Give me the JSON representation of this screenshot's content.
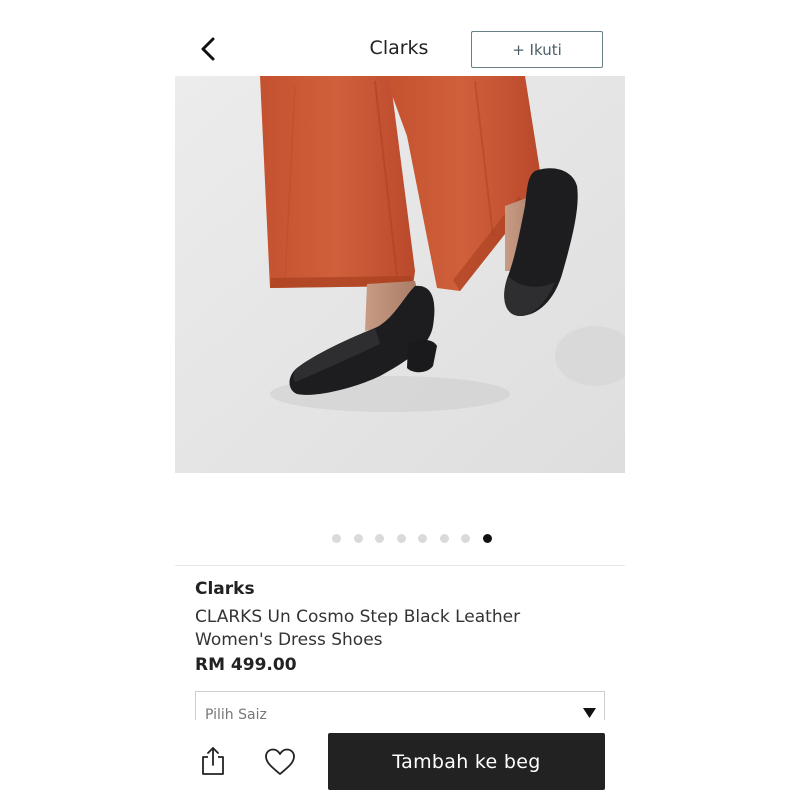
{
  "header": {
    "title": "Clarks",
    "follow_label": "+ Ikuti"
  },
  "gallery": {
    "total_images": 8,
    "active_index": 8
  },
  "product": {
    "brand": "Clarks",
    "name": "CLARKS Un Cosmo Step Black Leather Women's Dress Shoes",
    "price": "RM 499.00"
  },
  "size_selector": {
    "placeholder": "Pilih Saiz"
  },
  "actions": {
    "add_to_bag_label": "Tambah ke beg"
  },
  "colors": {
    "accent_dark": "#222222",
    "follow_border": "#6a7f86",
    "pants": "#c95536",
    "background_image": "#e5e5e5"
  },
  "icons": {
    "back": "chevron-left-icon",
    "share": "share-icon",
    "wishlist": "heart-icon",
    "dropdown": "caret-down-icon"
  }
}
